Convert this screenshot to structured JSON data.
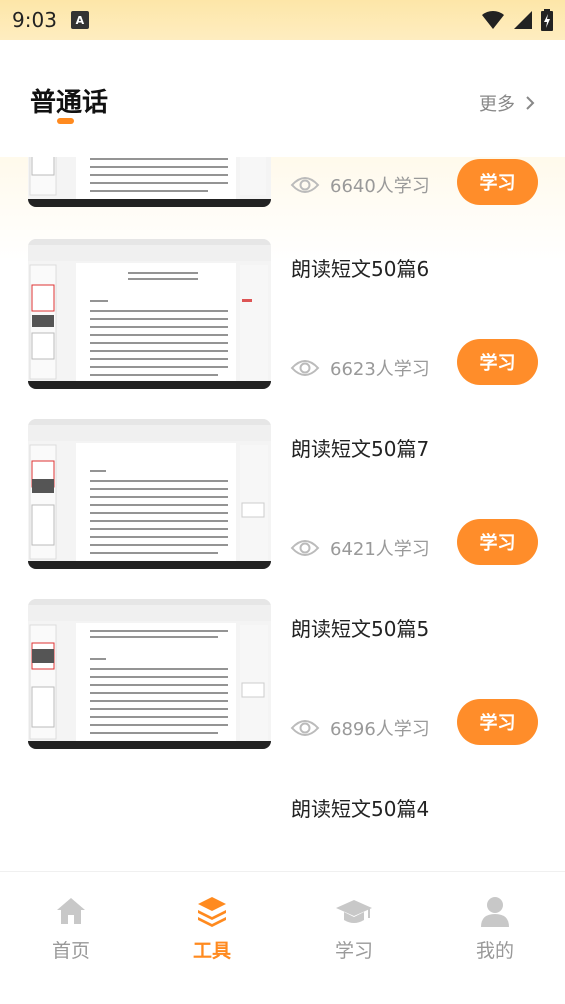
{
  "status": {
    "time": "9:03",
    "notification_letter": "A"
  },
  "header": {
    "title": "普通话",
    "more_label": "更多"
  },
  "items": [
    {
      "title": "",
      "views": "6640人学习",
      "button": "学习"
    },
    {
      "title": "朗读短文50篇6",
      "views": "6623人学习",
      "button": "学习"
    },
    {
      "title": "朗读短文50篇7",
      "views": "6421人学习",
      "button": "学习"
    },
    {
      "title": "朗读短文50篇5",
      "views": "6896人学习",
      "button": "学习"
    },
    {
      "title": "朗读短文50篇4"
    }
  ],
  "nav": {
    "items": [
      {
        "label": "首页",
        "icon": "home-icon"
      },
      {
        "label": "工具",
        "icon": "layers-icon",
        "active": true
      },
      {
        "label": "学习",
        "icon": "graduation-cap-icon"
      },
      {
        "label": "我的",
        "icon": "user-icon"
      }
    ]
  },
  "colors": {
    "accent": "#ff8a1f",
    "button": "#ff8d2a",
    "muted": "#999999"
  }
}
